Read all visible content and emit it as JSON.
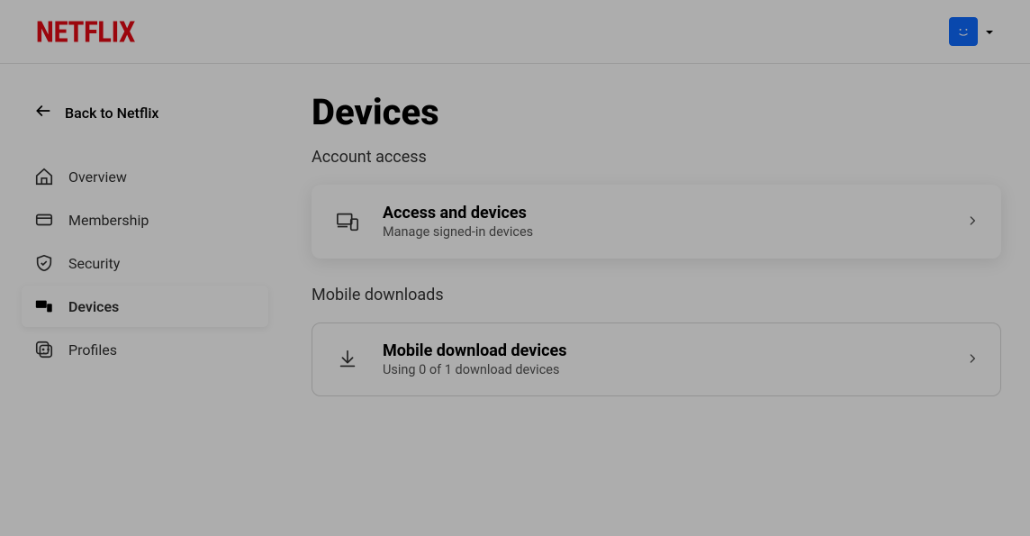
{
  "header": {
    "brand": "NETFLIX"
  },
  "sidebar": {
    "back_label": "Back to Netflix",
    "items": [
      {
        "label": "Overview"
      },
      {
        "label": "Membership"
      },
      {
        "label": "Security"
      },
      {
        "label": "Devices"
      },
      {
        "label": "Profiles"
      }
    ]
  },
  "main": {
    "title": "Devices",
    "sections": [
      {
        "heading": "Account access",
        "card": {
          "title": "Access and devices",
          "subtitle": "Manage signed-in devices"
        }
      },
      {
        "heading": "Mobile downloads",
        "card": {
          "title": "Mobile download devices",
          "subtitle": "Using 0 of 1 download devices"
        }
      }
    ]
  }
}
